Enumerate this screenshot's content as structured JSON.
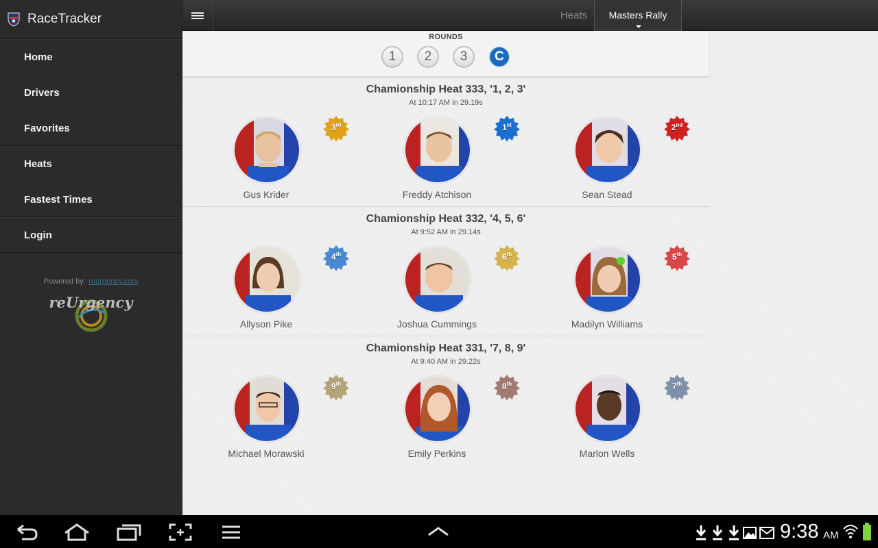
{
  "app": {
    "title": "RaceTracker"
  },
  "sidebar": {
    "items": [
      {
        "label": "Home"
      },
      {
        "label": "Drivers"
      },
      {
        "label": "Favorites"
      },
      {
        "label": "Heats"
      },
      {
        "label": "Fastest Times"
      },
      {
        "label": "Login"
      }
    ],
    "powered_by": "Powered by:",
    "powered_link": "reurgency.com",
    "brand_logo_text": "reUrgency"
  },
  "topbar": {
    "heats_label": "Heats",
    "event_label": "Masters Rally"
  },
  "rounds": {
    "label": "ROUNDS",
    "items": [
      "1",
      "2",
      "3",
      "C"
    ],
    "active": "C"
  },
  "heats": [
    {
      "title": "Chamionship Heat 333, '1, 2, 3'",
      "subtitle": "At 10:17 AM in 29.19s",
      "racers": [
        {
          "name": "Gus Krider",
          "place": "3",
          "suffix": "rd",
          "color": "#e0a21a"
        },
        {
          "name": "Freddy Atchison",
          "place": "1",
          "suffix": "st",
          "color": "#1a6fd0"
        },
        {
          "name": "Sean Stead",
          "place": "2",
          "suffix": "nd",
          "color": "#d02020"
        }
      ]
    },
    {
      "title": "Chamionship Heat 332, '4, 5, 6'",
      "subtitle": "At 9:52 AM in 29.14s",
      "racers": [
        {
          "name": "Allyson Pike",
          "place": "4",
          "suffix": "th",
          "color": "#4a88d0"
        },
        {
          "name": "Joshua Cummings",
          "place": "6",
          "suffix": "th",
          "color": "#d6b24e"
        },
        {
          "name": "Madilyn Williams",
          "place": "5",
          "suffix": "th",
          "color": "#d84848"
        }
      ]
    },
    {
      "title": "Chamionship Heat 331, '7, 8, 9'",
      "subtitle": "At 9:40 AM in 29.22s",
      "racers": [
        {
          "name": "Michael Morawski",
          "place": "9",
          "suffix": "th",
          "color": "#b5a47a"
        },
        {
          "name": "Emily Perkins",
          "place": "8",
          "suffix": "th",
          "color": "#a27a74"
        },
        {
          "name": "Marlon Wells",
          "place": "7",
          "suffix": "th",
          "color": "#7e91aa"
        }
      ]
    }
  ],
  "statusbar": {
    "time": "9:38",
    "ampm": "AM"
  }
}
